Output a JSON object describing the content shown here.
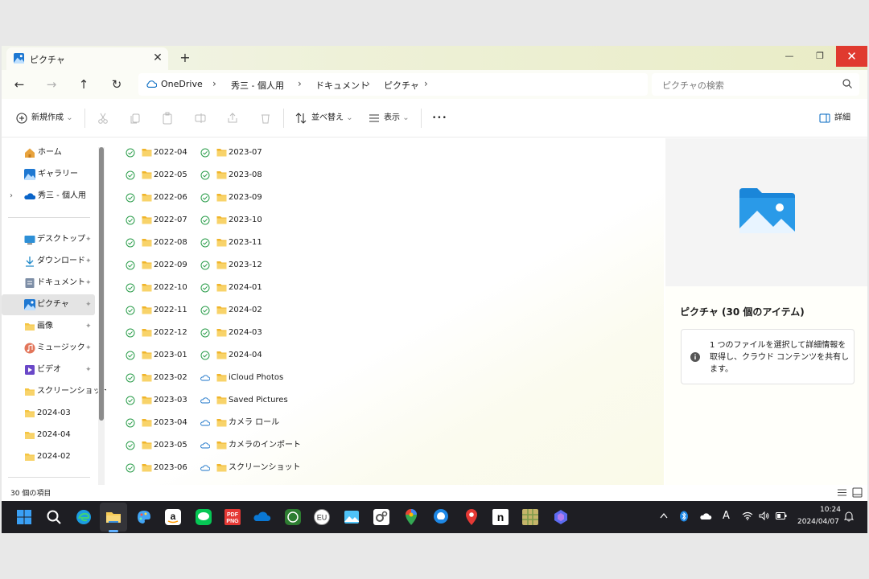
{
  "window": {
    "tab_title": "ピクチャ",
    "tab_close": "✕",
    "new_tab": "+",
    "min": "—",
    "max": "❐",
    "close": "✕"
  },
  "nav": {
    "back": "←",
    "forward": "→",
    "up": "↑",
    "refresh": "↻"
  },
  "breadcrumb": [
    "OneDrive",
    "秀三 - 個人用",
    "ドキュメント",
    "ピクチャ"
  ],
  "crumb_sep": "›",
  "search": {
    "placeholder": "ピクチャの検索"
  },
  "toolbar": {
    "new_label": "新規作成",
    "sort_label": "並べ替え",
    "view_label": "表示",
    "more_label": "•••",
    "details_label": "詳細",
    "caret": "⌄"
  },
  "sidebar": {
    "top": [
      {
        "label": "ホーム",
        "icon": "home-icon"
      },
      {
        "label": "ギャラリー",
        "icon": "gallery-icon"
      },
      {
        "label": "秀三 - 個人用",
        "icon": "cloud-icon",
        "chevron": "›"
      }
    ],
    "pinned": [
      {
        "label": "デスクトップ",
        "icon": "desktop-icon",
        "pin": "✦"
      },
      {
        "label": "ダウンロード",
        "icon": "download-icon",
        "pin": "✦"
      },
      {
        "label": "ドキュメント",
        "icon": "document-icon",
        "pin": "✦"
      },
      {
        "label": "ピクチャ",
        "icon": "pictures-icon",
        "pin": "✦",
        "selected": true
      },
      {
        "label": "画像",
        "icon": "folder-icon",
        "pin": "✦"
      },
      {
        "label": "ミュージック",
        "icon": "music-icon",
        "pin": "✦"
      },
      {
        "label": "ビデオ",
        "icon": "video-icon",
        "pin": "✦"
      },
      {
        "label": "スクリーンショット",
        "icon": "folder-icon"
      },
      {
        "label": "2024-03",
        "icon": "folder-icon"
      },
      {
        "label": "2024-04",
        "icon": "folder-icon"
      },
      {
        "label": "2024-02",
        "icon": "folder-icon"
      }
    ]
  },
  "files": {
    "col1": [
      "2022-04",
      "2022-05",
      "2022-06",
      "2022-07",
      "2022-08",
      "2022-09",
      "2022-10",
      "2022-11",
      "2022-12",
      "2023-01",
      "2023-02",
      "2023-03",
      "2023-04",
      "2023-05",
      "2023-06"
    ],
    "col2": [
      {
        "name": "2023-07",
        "status": "synced"
      },
      {
        "name": "2023-08",
        "status": "synced"
      },
      {
        "name": "2023-09",
        "status": "synced"
      },
      {
        "name": "2023-10",
        "status": "synced"
      },
      {
        "name": "2023-11",
        "status": "synced"
      },
      {
        "name": "2023-12",
        "status": "synced"
      },
      {
        "name": "2024-01",
        "status": "synced"
      },
      {
        "name": "2024-02",
        "status": "synced"
      },
      {
        "name": "2024-03",
        "status": "synced"
      },
      {
        "name": "2024-04",
        "status": "synced"
      },
      {
        "name": "iCloud Photos",
        "status": "cloud"
      },
      {
        "name": "Saved Pictures",
        "status": "cloud"
      },
      {
        "name": "カメラ ロール",
        "status": "cloud"
      },
      {
        "name": "カメラのインポート",
        "status": "cloud"
      },
      {
        "name": "スクリーンショット",
        "status": "cloud"
      }
    ]
  },
  "details": {
    "title": "ピクチャ (30 個のアイテム)",
    "info": "1 つのファイルを選択して詳細情報を取得し、クラウド コンテンツを共有します。"
  },
  "statusbar": {
    "count": "30 個の項目"
  },
  "taskbar": {
    "apps": [
      "windows-start-icon",
      "search-icon",
      "edge-icon",
      "file-explorer-icon",
      "paint-icon",
      "amazon-icon",
      "line-icon",
      "pdf-png-icon",
      "onedrive-icon",
      "whatsapp-icon",
      "eu-icon",
      "photos-icon",
      "settings-icon",
      "maps-pin-icon",
      "location-icon",
      "pin-icon",
      "notion-icon",
      "map-icon",
      "copilot-icon"
    ],
    "time": "10:24",
    "date": "2024/04/07",
    "chevron": "^",
    "ime": "A",
    "pdf_line1": "PDF",
    "pdf_line2": "PNG",
    "amazon": "a",
    "eu": "EU",
    "notion": "n"
  },
  "colors": {
    "accent": "#0067c0",
    "folder": "#f5c542",
    "synced": "#2a9d4a",
    "close": "#e03a2f",
    "taskbar": "#1e1e23"
  }
}
